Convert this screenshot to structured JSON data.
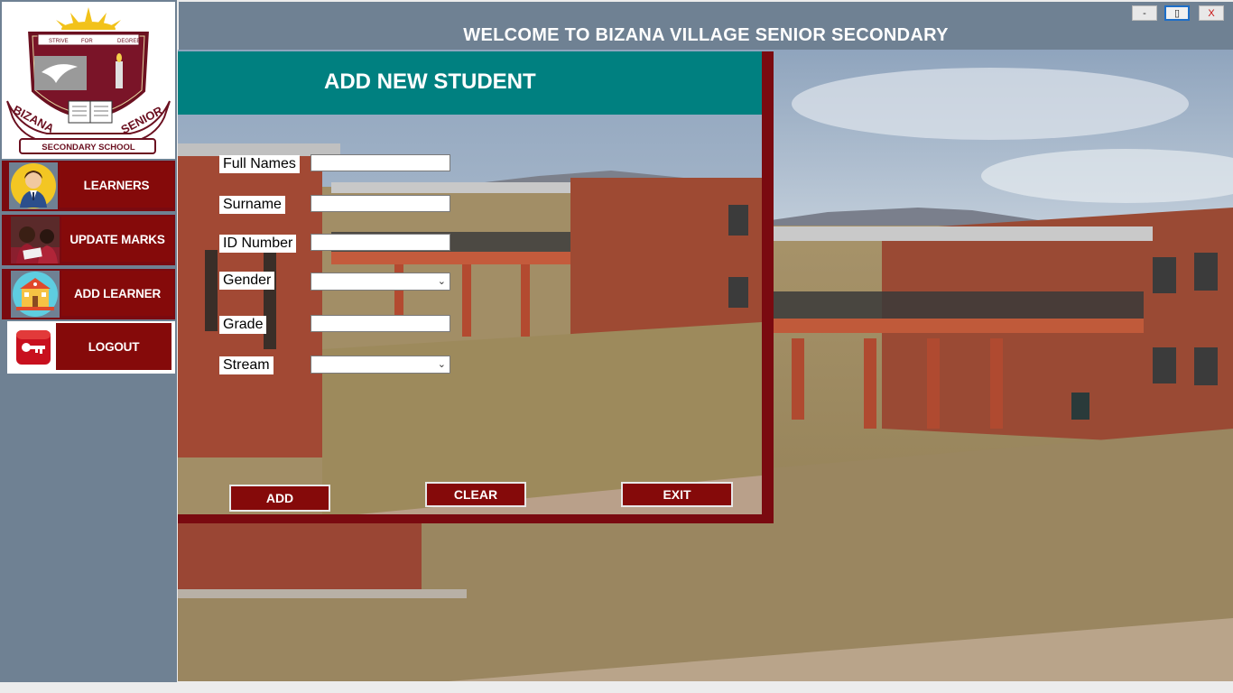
{
  "app": {
    "title": "WELCOME TO BIZANA VILLAGE SENIOR SECONDARY"
  },
  "window_controls": {
    "minimize": "-",
    "maximize": "▯",
    "close": "X"
  },
  "logo": {
    "top_text": "STRIVE",
    "for_text": "FOR",
    "right_text": "DEGREE",
    "band_left": "BIZANA",
    "band_right": "SENIOR",
    "bottom": "SECONDARY SCHOOL"
  },
  "sidebar": {
    "items": [
      {
        "label": "LEARNERS"
      },
      {
        "label": "UPDATE MARKS"
      },
      {
        "label": "ADD LEARNER"
      },
      {
        "label": "LOGOUT"
      }
    ]
  },
  "form": {
    "title": "ADD NEW STUDENT",
    "fields": {
      "full_names": {
        "label": "Full Names",
        "value": ""
      },
      "surname": {
        "label": "Surname",
        "value": ""
      },
      "id_number": {
        "label": "ID Number",
        "value": ""
      },
      "gender": {
        "label": "Gender",
        "value": ""
      },
      "grade": {
        "label": "Grade",
        "value": ""
      },
      "stream": {
        "label": "Stream",
        "value": ""
      }
    },
    "buttons": {
      "add": "ADD",
      "clear": "CLEAR",
      "exit": "EXIT"
    }
  },
  "colors": {
    "maroon": "#850a0a",
    "teal": "#008080",
    "slate": "#6f8193"
  }
}
